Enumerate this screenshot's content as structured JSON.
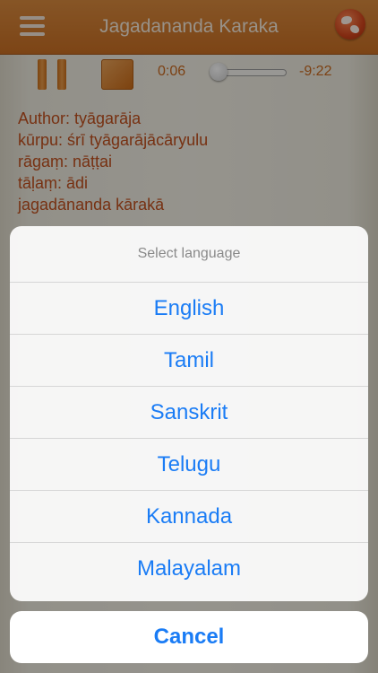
{
  "navbar": {
    "title": "Jagadananda Karaka",
    "menu_icon": "hamburger-menu-icon",
    "globe_icon": "globe-icon"
  },
  "player": {
    "pause_icon": "pause-icon",
    "stop_icon": "stop-icon",
    "elapsed": "0:06",
    "remaining": "-9:22",
    "progress_fraction": 0.01
  },
  "lyrics": {
    "lines": [
      "Author: tyāgarāja",
      "kūrpu: śrī tyāgarājācāryulu",
      "rāgaṃ: nāṭṭai",
      "tāḷaṃ: ādi",
      "jagadānanda kārakā"
    ]
  },
  "language_sheet": {
    "title": "Select language",
    "options": [
      "English",
      "Tamil",
      "Sanskrit",
      "Telugu",
      "Kannada",
      "Malayalam"
    ],
    "cancel_label": "Cancel"
  },
  "colors": {
    "navbar": "#cf7a30",
    "lyrics_text": "#c0501e",
    "action_blue": "#1a7cf5"
  }
}
